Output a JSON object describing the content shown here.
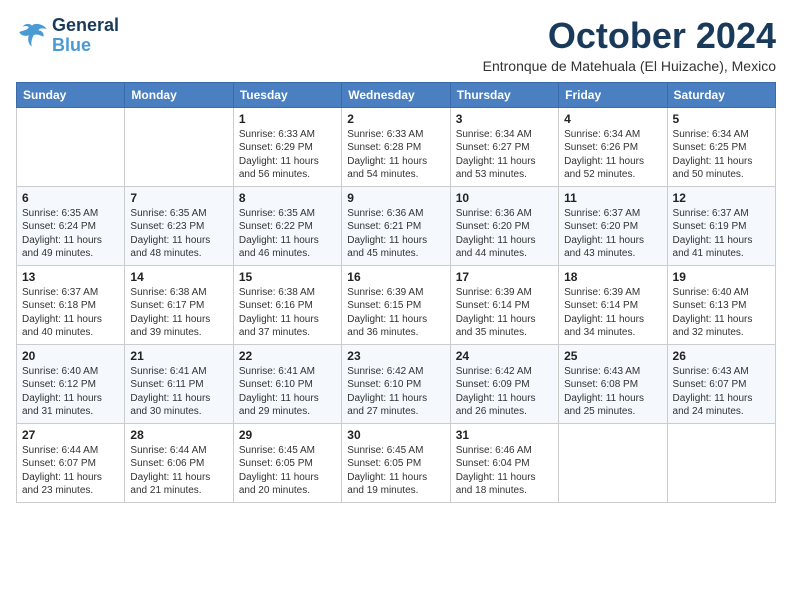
{
  "logo": {
    "line1": "General",
    "line2": "Blue"
  },
  "title": "October 2024",
  "subtitle": "Entronque de Matehuala (El Huizache), Mexico",
  "header_days": [
    "Sunday",
    "Monday",
    "Tuesday",
    "Wednesday",
    "Thursday",
    "Friday",
    "Saturday"
  ],
  "weeks": [
    [
      {
        "day": "",
        "text": ""
      },
      {
        "day": "",
        "text": ""
      },
      {
        "day": "1",
        "text": "Sunrise: 6:33 AM\nSunset: 6:29 PM\nDaylight: 11 hours and 56 minutes."
      },
      {
        "day": "2",
        "text": "Sunrise: 6:33 AM\nSunset: 6:28 PM\nDaylight: 11 hours and 54 minutes."
      },
      {
        "day": "3",
        "text": "Sunrise: 6:34 AM\nSunset: 6:27 PM\nDaylight: 11 hours and 53 minutes."
      },
      {
        "day": "4",
        "text": "Sunrise: 6:34 AM\nSunset: 6:26 PM\nDaylight: 11 hours and 52 minutes."
      },
      {
        "day": "5",
        "text": "Sunrise: 6:34 AM\nSunset: 6:25 PM\nDaylight: 11 hours and 50 minutes."
      }
    ],
    [
      {
        "day": "6",
        "text": "Sunrise: 6:35 AM\nSunset: 6:24 PM\nDaylight: 11 hours and 49 minutes."
      },
      {
        "day": "7",
        "text": "Sunrise: 6:35 AM\nSunset: 6:23 PM\nDaylight: 11 hours and 48 minutes."
      },
      {
        "day": "8",
        "text": "Sunrise: 6:35 AM\nSunset: 6:22 PM\nDaylight: 11 hours and 46 minutes."
      },
      {
        "day": "9",
        "text": "Sunrise: 6:36 AM\nSunset: 6:21 PM\nDaylight: 11 hours and 45 minutes."
      },
      {
        "day": "10",
        "text": "Sunrise: 6:36 AM\nSunset: 6:20 PM\nDaylight: 11 hours and 44 minutes."
      },
      {
        "day": "11",
        "text": "Sunrise: 6:37 AM\nSunset: 6:20 PM\nDaylight: 11 hours and 43 minutes."
      },
      {
        "day": "12",
        "text": "Sunrise: 6:37 AM\nSunset: 6:19 PM\nDaylight: 11 hours and 41 minutes."
      }
    ],
    [
      {
        "day": "13",
        "text": "Sunrise: 6:37 AM\nSunset: 6:18 PM\nDaylight: 11 hours and 40 minutes."
      },
      {
        "day": "14",
        "text": "Sunrise: 6:38 AM\nSunset: 6:17 PM\nDaylight: 11 hours and 39 minutes."
      },
      {
        "day": "15",
        "text": "Sunrise: 6:38 AM\nSunset: 6:16 PM\nDaylight: 11 hours and 37 minutes."
      },
      {
        "day": "16",
        "text": "Sunrise: 6:39 AM\nSunset: 6:15 PM\nDaylight: 11 hours and 36 minutes."
      },
      {
        "day": "17",
        "text": "Sunrise: 6:39 AM\nSunset: 6:14 PM\nDaylight: 11 hours and 35 minutes."
      },
      {
        "day": "18",
        "text": "Sunrise: 6:39 AM\nSunset: 6:14 PM\nDaylight: 11 hours and 34 minutes."
      },
      {
        "day": "19",
        "text": "Sunrise: 6:40 AM\nSunset: 6:13 PM\nDaylight: 11 hours and 32 minutes."
      }
    ],
    [
      {
        "day": "20",
        "text": "Sunrise: 6:40 AM\nSunset: 6:12 PM\nDaylight: 11 hours and 31 minutes."
      },
      {
        "day": "21",
        "text": "Sunrise: 6:41 AM\nSunset: 6:11 PM\nDaylight: 11 hours and 30 minutes."
      },
      {
        "day": "22",
        "text": "Sunrise: 6:41 AM\nSunset: 6:10 PM\nDaylight: 11 hours and 29 minutes."
      },
      {
        "day": "23",
        "text": "Sunrise: 6:42 AM\nSunset: 6:10 PM\nDaylight: 11 hours and 27 minutes."
      },
      {
        "day": "24",
        "text": "Sunrise: 6:42 AM\nSunset: 6:09 PM\nDaylight: 11 hours and 26 minutes."
      },
      {
        "day": "25",
        "text": "Sunrise: 6:43 AM\nSunset: 6:08 PM\nDaylight: 11 hours and 25 minutes."
      },
      {
        "day": "26",
        "text": "Sunrise: 6:43 AM\nSunset: 6:07 PM\nDaylight: 11 hours and 24 minutes."
      }
    ],
    [
      {
        "day": "27",
        "text": "Sunrise: 6:44 AM\nSunset: 6:07 PM\nDaylight: 11 hours and 23 minutes."
      },
      {
        "day": "28",
        "text": "Sunrise: 6:44 AM\nSunset: 6:06 PM\nDaylight: 11 hours and 21 minutes."
      },
      {
        "day": "29",
        "text": "Sunrise: 6:45 AM\nSunset: 6:05 PM\nDaylight: 11 hours and 20 minutes."
      },
      {
        "day": "30",
        "text": "Sunrise: 6:45 AM\nSunset: 6:05 PM\nDaylight: 11 hours and 19 minutes."
      },
      {
        "day": "31",
        "text": "Sunrise: 6:46 AM\nSunset: 6:04 PM\nDaylight: 11 hours and 18 minutes."
      },
      {
        "day": "",
        "text": ""
      },
      {
        "day": "",
        "text": ""
      }
    ]
  ]
}
